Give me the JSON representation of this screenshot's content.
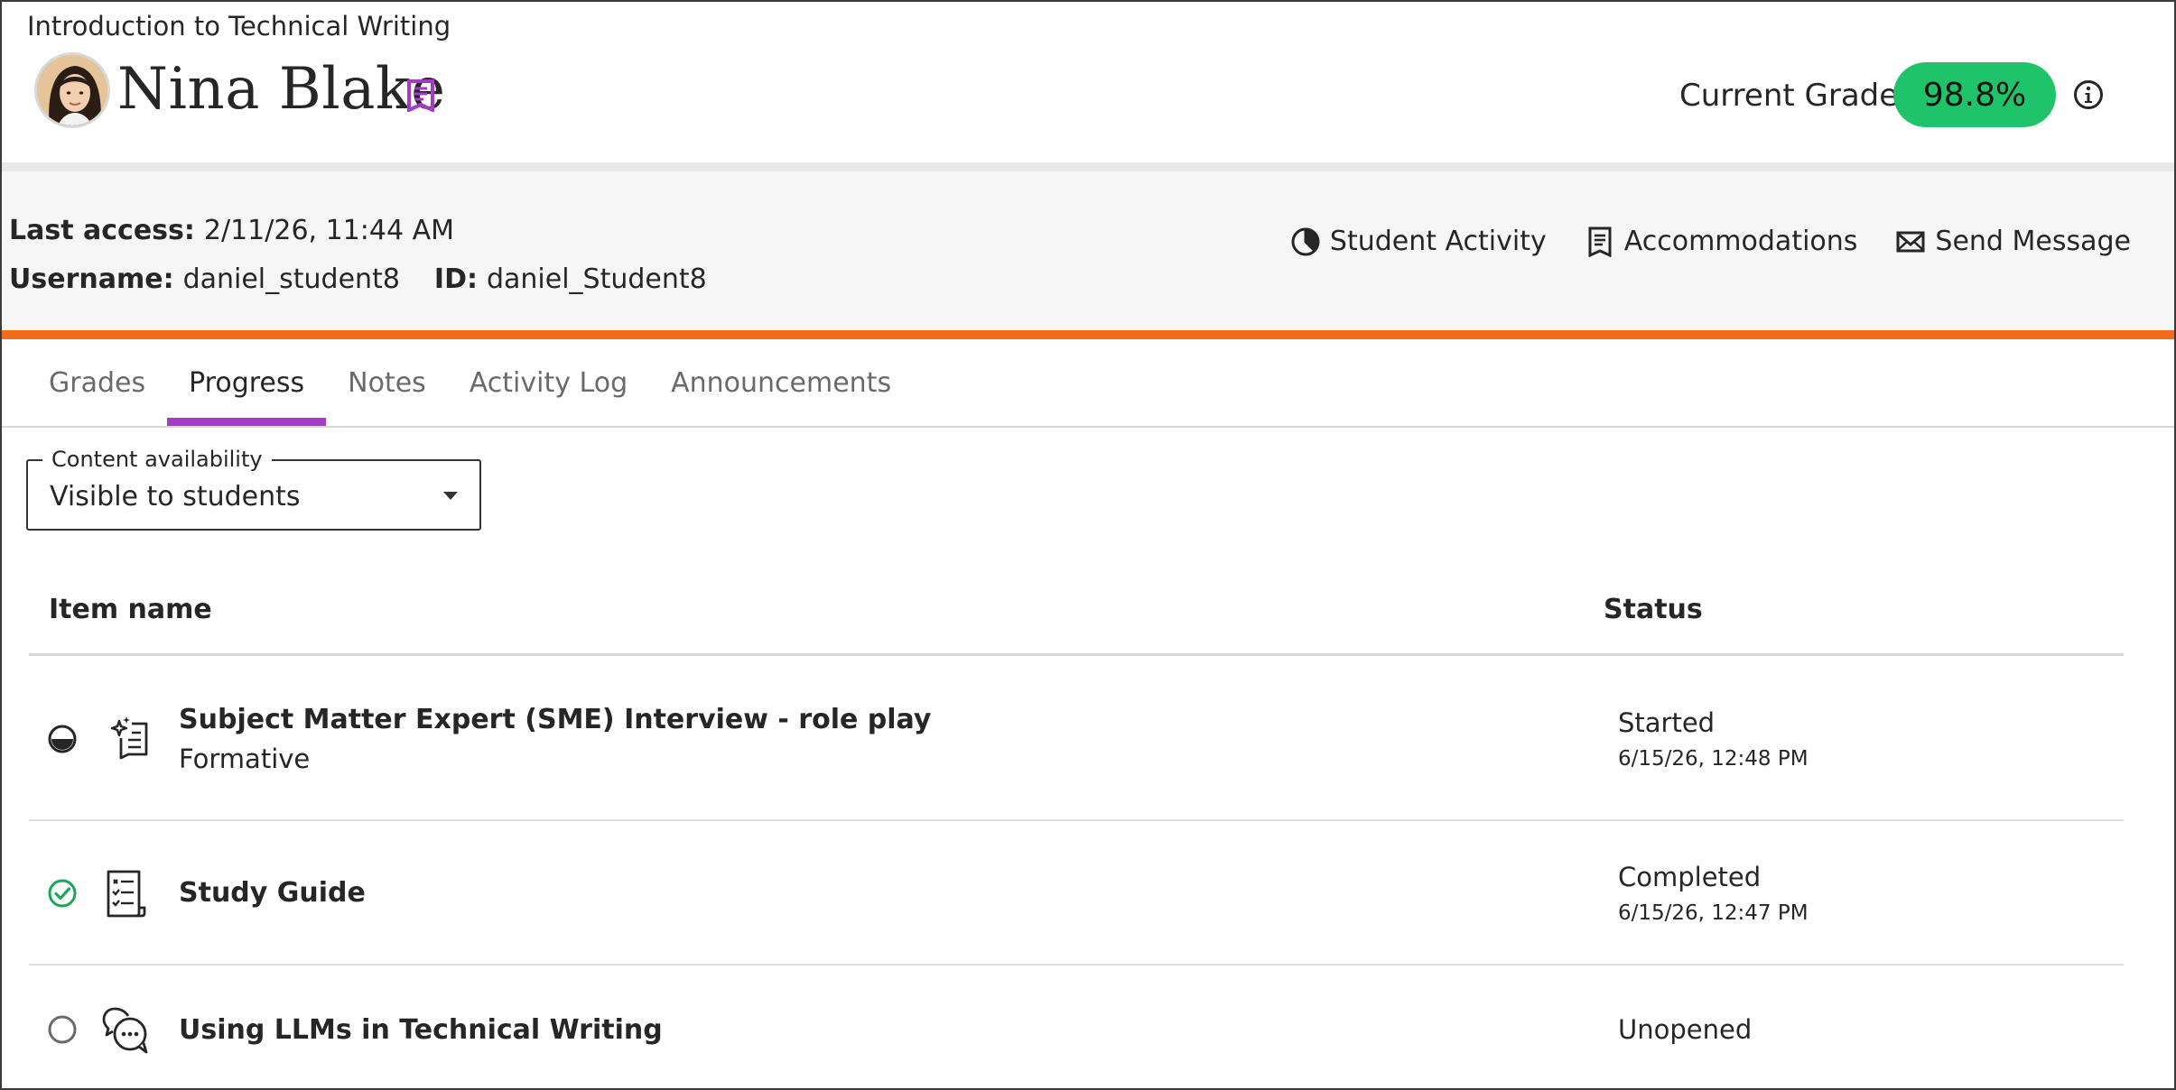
{
  "header": {
    "course_title": "Introduction to Technical Writing",
    "student_name": "Nina Blake",
    "grade_label": "Current Grade",
    "grade_value": "98.8%"
  },
  "info": {
    "last_access_label": "Last access:",
    "last_access_value": "2/11/26, 11:44 AM",
    "username_label": "Username:",
    "username_value": "daniel_student8",
    "id_label": "ID:",
    "id_value": "daniel_Student8"
  },
  "actions": [
    {
      "label": "Student Activity",
      "icon": "pie-chart-icon"
    },
    {
      "label": "Accommodations",
      "icon": "document-icon"
    },
    {
      "label": "Send Message",
      "icon": "mail-icon"
    }
  ],
  "tabs": [
    {
      "label": "Grades",
      "active": false
    },
    {
      "label": "Progress",
      "active": true
    },
    {
      "label": "Notes",
      "active": false
    },
    {
      "label": "Activity Log",
      "active": false
    },
    {
      "label": "Announcements",
      "active": false
    }
  ],
  "filter": {
    "legend": "Content availability",
    "value": "Visible to students"
  },
  "table": {
    "col_item": "Item name",
    "col_status": "Status",
    "rows": [
      {
        "title": "Subject Matter Expert (SME) Interview - role play",
        "subtitle": "Formative",
        "status": "Started",
        "date": "6/15/26, 12:48 PM",
        "state_icon": "half-progress-icon",
        "type_icon": "ai-conversation-icon"
      },
      {
        "title": "Study Guide",
        "subtitle": "",
        "status": "Completed",
        "date": "6/15/26, 12:47 PM",
        "state_icon": "check-circle-icon",
        "type_icon": "checklist-document-icon"
      },
      {
        "title": "Using LLMs in Technical Writing",
        "subtitle": "",
        "status": "Unopened",
        "date": "",
        "state_icon": "empty-circle-icon",
        "type_icon": "discussion-icon"
      }
    ]
  },
  "colors": {
    "accent_orange": "#f26a1c",
    "tab_active": "#a63bc7",
    "grade_green": "#1ec36a",
    "complete_green": "#1aa75a",
    "accommodation_purple": "#a63bc7"
  }
}
